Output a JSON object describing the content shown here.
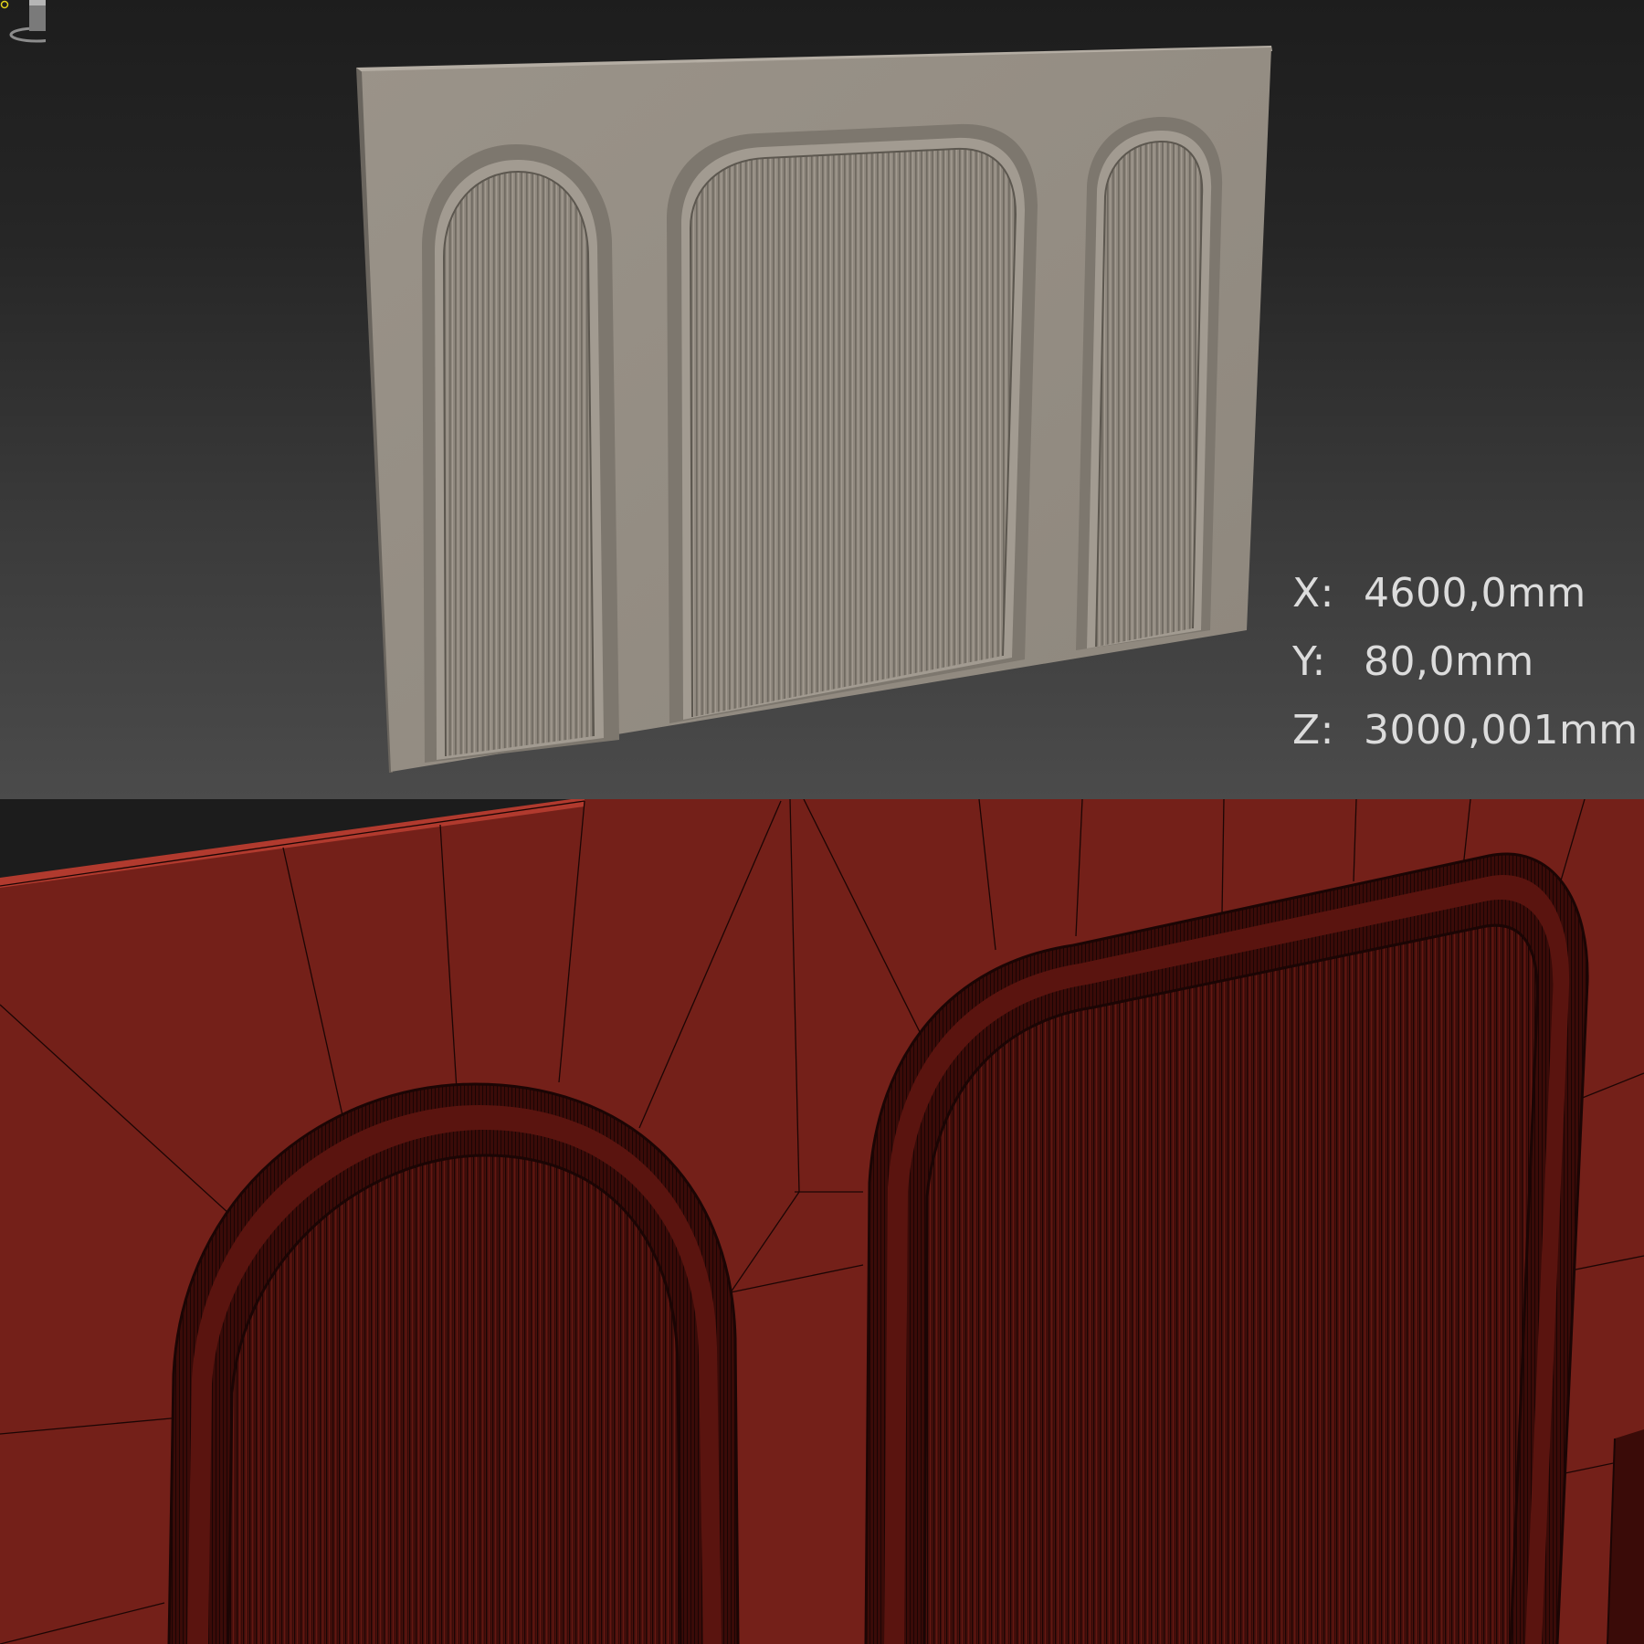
{
  "viewport_top": {
    "dimensions": [
      {
        "axis": "X:",
        "value": "4600,0mm"
      },
      {
        "axis": "Y:",
        "value": "80,0mm"
      },
      {
        "axis": "Z:",
        "value": "3000,001mm"
      }
    ],
    "colors": {
      "wall": "#979086",
      "background_top": "#1d1d1d",
      "background_bottom": "#4b4b4b",
      "pivot": "#e3d21c"
    },
    "icons": [
      "viewcube-icon",
      "pivot-icon"
    ]
  },
  "viewport_bottom": {
    "colors": {
      "mesh": "#742019",
      "wire": "#1b0504",
      "dark_panel": "#3a0b08"
    }
  }
}
